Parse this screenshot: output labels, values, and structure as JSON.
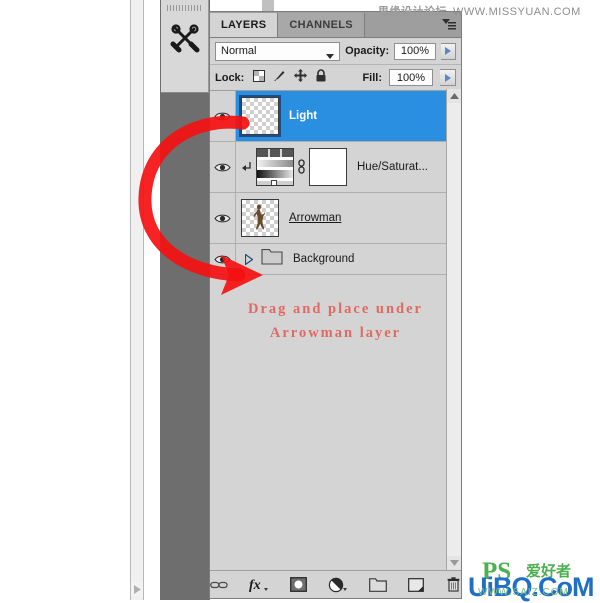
{
  "app": {
    "panel_tabs": [
      {
        "label": "LAYERS",
        "active": true
      },
      {
        "label": "CHANNELS",
        "active": false
      }
    ],
    "panel_menu_icon": "panel-menu-icon",
    "tool_dock_icon": "tools-wrench-screwdriver-icon"
  },
  "options": {
    "blend_mode": "Normal",
    "opacity_label": "Opacity:",
    "opacity_value": "100%",
    "fill_label": "Fill:",
    "fill_value": "100%",
    "lock_label": "Lock:",
    "lock_icons": [
      "lock-transparent-pixels-icon",
      "lock-image-pixels-icon",
      "lock-position-icon",
      "lock-all-icon"
    ],
    "blend_caret_icon": "chevron-down-icon",
    "opacity_spinner_icon": "spinner-arrow-icon",
    "fill_spinner_icon": "spinner-arrow-icon"
  },
  "layers": [
    {
      "name": "Light",
      "type": "pixel",
      "selected": true,
      "visible": true,
      "thumb": "transparent-checker-thumbnail",
      "eye_icon": "eye-visibility-icon"
    },
    {
      "name": "Hue/Saturat...",
      "type": "adjustment",
      "selected": false,
      "visible": true,
      "clipped": true,
      "thumb": "hue-saturation-gradient-thumbnail",
      "mask": "white-layer-mask-thumbnail",
      "link_icon": "link-chain-icon",
      "clip_icon": "clipping-mask-arrow-icon",
      "eye_icon": "eye-visibility-icon"
    },
    {
      "name": "Arrowman",
      "type": "pixel",
      "selected": false,
      "visible": true,
      "thumb": "arrowman-figure-thumbnail",
      "eye_icon": "eye-visibility-icon"
    },
    {
      "name": "Background",
      "type": "group",
      "selected": false,
      "visible": true,
      "collapsed": true,
      "disclosure_icon": "disclosure-triangle-right-icon",
      "folder_icon": "folder-icon",
      "eye_icon": "eye-visibility-icon"
    }
  ],
  "annotation": {
    "line1": "Drag and place under",
    "line2": "Arrowman layer",
    "color": "#e06a62",
    "arrow_icon": "red-curved-arrow"
  },
  "footer": {
    "buttons": [
      {
        "name": "link-layers-button",
        "icon": "link-chain-icon"
      },
      {
        "name": "layer-style-button",
        "icon": "fx-icon"
      },
      {
        "name": "add-layer-mask-button",
        "icon": "layer-mask-icon"
      },
      {
        "name": "new-adjustment-layer-button",
        "icon": "half-filled-circle-icon"
      },
      {
        "name": "new-group-button",
        "icon": "folder-icon"
      },
      {
        "name": "new-layer-button",
        "icon": "new-layer-icon"
      },
      {
        "name": "delete-layer-button",
        "icon": "trash-icon"
      }
    ]
  },
  "scrollbars": {
    "panel_up_icon": "scroll-up-arrow-icon",
    "panel_down_icon": "scroll-down-arrow-icon",
    "gutter_down_icon": "scroll-down-arrow-icon",
    "gutter_right_icon": "scroll-right-arrow-icon"
  },
  "watermarks": {
    "top_cn": "思缘设计论坛",
    "top_url": "WWW.MISSYUAN.COM",
    "bottom_main": "UiBQ.CoM",
    "bottom_ps": "PS",
    "bottom_cn": "爱好者",
    "bottom_sub": "WWW.SAIZ.COM"
  },
  "colors": {
    "panel_bg": "#d4d4d4",
    "selection_blue": "#2a8fe0",
    "annotation_red": "#e06a62",
    "app_dark": "#6e6e6e",
    "watermark_blue": "#1f6fc4",
    "watermark_green": "#4caf50"
  }
}
